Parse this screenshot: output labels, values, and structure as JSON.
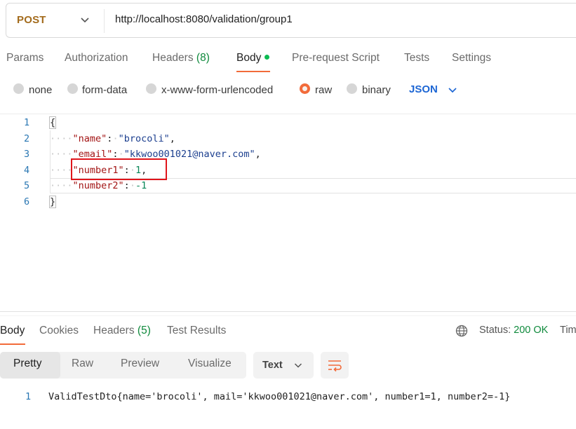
{
  "request": {
    "method": "POST",
    "url": "http://localhost:8080/validation/group1"
  },
  "request_tabs": {
    "params": "Params",
    "authorization": "Authorization",
    "headers_label": "Headers",
    "headers_count": "(8)",
    "body": "Body",
    "prerequest": "Pre-request Script",
    "tests": "Tests",
    "settings": "Settings"
  },
  "body_types": {
    "none": "none",
    "form_data": "form-data",
    "urlencoded": "x-www-form-urlencoded",
    "raw": "raw",
    "binary": "binary",
    "selected": "raw",
    "format": "JSON"
  },
  "editor": {
    "line_numbers": [
      "1",
      "2",
      "3",
      "4",
      "5",
      "6"
    ],
    "open_brace": "{",
    "close_brace": "}",
    "indent_dots": "····",
    "fields": [
      {
        "key": "\"name\"",
        "value": "\"brocoli\"",
        "comma": ","
      },
      {
        "key": "\"email\"",
        "value": "\"kkwoo001021@naver.com\"",
        "comma": ","
      },
      {
        "key": "\"number1\"",
        "value": "1",
        "comma": ","
      },
      {
        "key": "\"number2\"",
        "value": "-1",
        "comma": ""
      }
    ],
    "colon": ":",
    "space_dot": "·"
  },
  "response_tabs": {
    "body": "Body",
    "cookies": "Cookies",
    "headers_label": "Headers",
    "headers_count": "(5)",
    "test_results": "Test Results"
  },
  "response_status": {
    "status_label": "Status:",
    "status_value": "200 OK",
    "time_label": "Tim"
  },
  "view_modes": {
    "pretty": "Pretty",
    "raw": "Raw",
    "preview": "Preview",
    "visualize": "Visualize",
    "format": "Text"
  },
  "response_body": {
    "line_number": "1",
    "text": "ValidTestDto{name='brocoli', mail='kkwoo001021@naver.com', number1=1, number2=-1}"
  },
  "colors": {
    "accent": "#f26b3a",
    "method": "#a36b1c",
    "json_blue": "#1d66d4",
    "success_green": "#0f8a3c",
    "highlight_red": "#e0151b"
  },
  "icons": {
    "method_dropdown": "chevron-down-icon",
    "format_dropdown": "chevron-down-icon",
    "globe": "globe-icon",
    "wrap": "wrap-lines-icon"
  }
}
